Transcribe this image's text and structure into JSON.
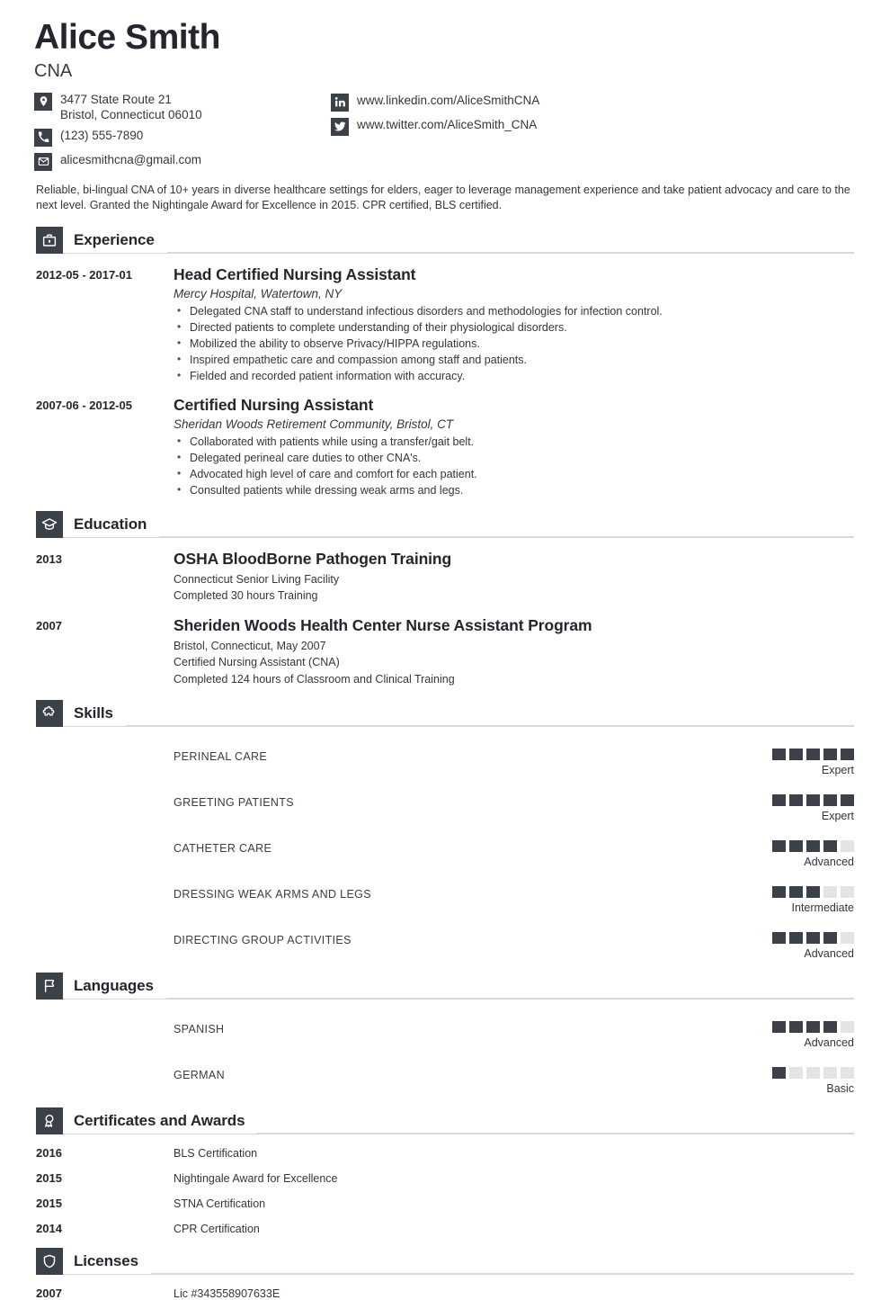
{
  "header": {
    "name": "Alice Smith",
    "job_title": "CNA",
    "contacts_left": [
      {
        "icon": "location-pin-icon",
        "line1": "3477 State Route 21",
        "line2": "Bristol, Connecticut 06010"
      },
      {
        "icon": "phone-icon",
        "line1": "(123) 555-7890",
        "line2": ""
      },
      {
        "icon": "email-icon",
        "line1": "alicesmithcna@gmail.com",
        "line2": ""
      }
    ],
    "contacts_right": [
      {
        "icon": "linkedin-icon",
        "line1": "www.linkedin.com/AliceSmithCNA",
        "line2": ""
      },
      {
        "icon": "twitter-icon",
        "line1": "www.twitter.com/AliceSmith_CNA",
        "line2": ""
      }
    ]
  },
  "summary": "Reliable, bi-lingual CNA of 10+ years in diverse healthcare settings for elders, eager to leverage management experience and take patient advocacy and care to the next level. Granted the Nightingale Award for Excellence in 2015. CPR certified, BLS certified.",
  "sections": {
    "experience": {
      "title": "Experience",
      "icon": "briefcase-icon",
      "entries": [
        {
          "date": "2012-05 - 2017-01",
          "title": "Head Certified Nursing Assistant",
          "subtitle": "Mercy Hospital, Watertown, NY",
          "bullets": [
            "Delegated CNA staff to understand infectious disorders and methodologies for infection control.",
            "Directed patients to complete understanding of their physiological disorders.",
            "Mobilized the ability to observe Privacy/HIPPA regulations.",
            "Inspired empathetic care and compassion among staff and patients.",
            "Fielded and recorded patient information with accuracy."
          ]
        },
        {
          "date": "2007-06 - 2012-05",
          "title": "Certified Nursing Assistant",
          "subtitle": "Sheridan Woods Retirement Community, Bristol, CT",
          "bullets": [
            "Collaborated with patients while using a transfer/gait belt.",
            "Delegated perineal care duties to other CNA's.",
            "Advocated high level of care and comfort for each patient.",
            "Consulted patients while dressing weak arms and legs."
          ]
        }
      ]
    },
    "education": {
      "title": "Education",
      "icon": "graduation-cap-icon",
      "entries": [
        {
          "date": "2013",
          "title": "OSHA BloodBorne Pathogen Training",
          "lines": [
            "Connecticut Senior Living Facility",
            "Completed 30 hours Training"
          ]
        },
        {
          "date": "2007",
          "title": "Sheriden Woods Health Center Nurse Assistant Program",
          "lines": [
            "Bristol, Connecticut, May 2007",
            "Certified Nursing Assistant (CNA)",
            "Completed 124 hours of Classroom and Clinical Training"
          ]
        }
      ]
    },
    "skills": {
      "title": "Skills",
      "icon": "puzzle-piece-icon",
      "max_level": 5,
      "items": [
        {
          "label": "PERINEAL CARE",
          "level": 5,
          "level_text": "Expert"
        },
        {
          "label": "GREETING PATIENTS",
          "level": 5,
          "level_text": "Expert"
        },
        {
          "label": "CATHETER CARE",
          "level": 4,
          "level_text": "Advanced"
        },
        {
          "label": "DRESSING WEAK ARMS AND LEGS",
          "level": 3,
          "level_text": "Intermediate"
        },
        {
          "label": "DIRECTING GROUP ACTIVITIES",
          "level": 4,
          "level_text": "Advanced"
        }
      ]
    },
    "languages": {
      "title": "Languages",
      "icon": "flag-icon",
      "max_level": 5,
      "items": [
        {
          "label": "SPANISH",
          "level": 4,
          "level_text": "Advanced"
        },
        {
          "label": "GERMAN",
          "level": 1,
          "level_text": "Basic"
        }
      ]
    },
    "certificates": {
      "title": "Certificates and Awards",
      "icon": "award-ribbon-icon",
      "items": [
        {
          "date": "2016",
          "text": "BLS Certification"
        },
        {
          "date": "2015",
          "text": "Nightingale Award for Excellence"
        },
        {
          "date": "2015",
          "text": "STNA Certification"
        },
        {
          "date": "2014",
          "text": "CPR Certification"
        }
      ]
    },
    "licenses": {
      "title": "Licenses",
      "icon": "shield-icon",
      "items": [
        {
          "date": "2007",
          "text": "Lic #343558907633E"
        }
      ]
    }
  },
  "colors": {
    "accent_dark": "#3c4049",
    "text": "#33363d",
    "heading": "#23262c",
    "rule": "#d8d8d8",
    "square_empty": "#e4e4e4"
  }
}
